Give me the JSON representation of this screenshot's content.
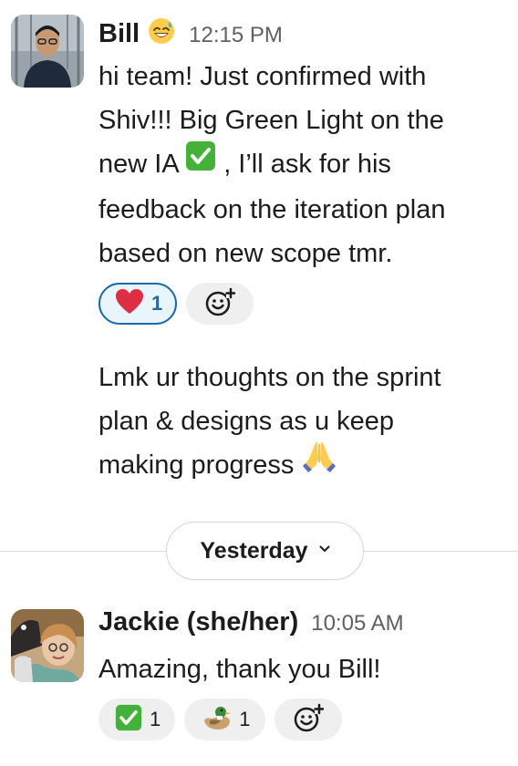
{
  "messages": [
    {
      "author": "Bill",
      "status_emoji": "grinning-sweat-emoji",
      "timestamp": "12:15 PM",
      "lines": [
        "hi team! Just confirmed with",
        "Shiv!!! Big Green Light on the",
        "new IA",
        ", I’ll ask for his",
        "feedback on the iteration plan",
        "based on new scope tmr."
      ],
      "reactions": [
        {
          "emoji": "red-heart-emoji",
          "count": "1",
          "active": true
        }
      ],
      "followup_lines": [
        "Lmk ur thoughts on the sprint",
        "plan & designs as u keep",
        "making progress"
      ]
    },
    {
      "author": "Jackie (she/her)",
      "timestamp": "10:05 AM",
      "lines": [
        "Amazing, thank you Bill!"
      ],
      "reactions": [
        {
          "emoji": "check-mark-button-emoji",
          "count": "1",
          "active": false
        },
        {
          "emoji": "duck-emoji",
          "count": "1",
          "active": false
        }
      ]
    }
  ],
  "date_divider": {
    "label": "Yesterday"
  },
  "colors": {
    "active_reaction_border": "#1d6aa8",
    "active_reaction_bg": "#e8f5fa",
    "reaction_bg": "#efefef",
    "timestamp": "#616061",
    "check_green": "#44b13a"
  }
}
